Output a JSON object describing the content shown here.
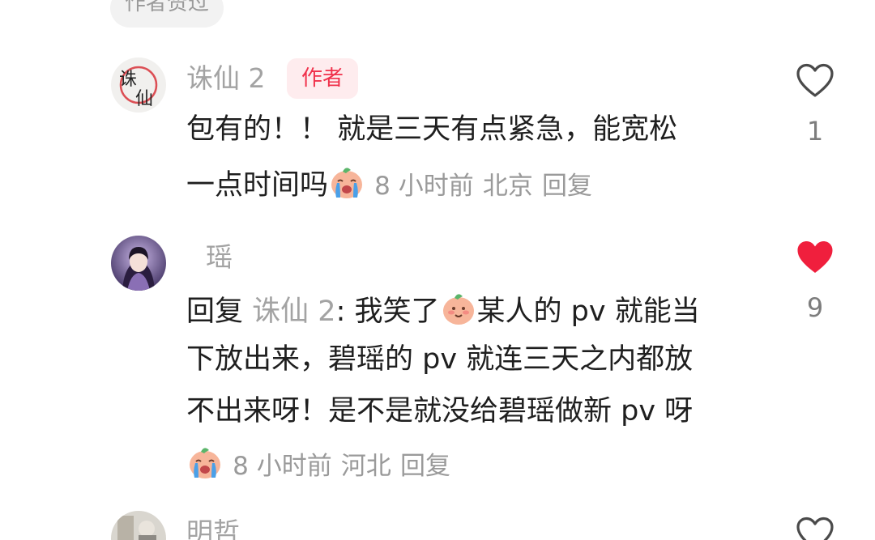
{
  "top_badge": {
    "label": "作者赞过"
  },
  "comments": [
    {
      "username": "诛仙 2",
      "author_badge": "作者",
      "lines": [
        "包有的！！ 就是三天有点紧急，能宽松",
        "一点时间吗"
      ],
      "emoji": "crying-face-emoji",
      "time": "8 小时前",
      "location": "北京",
      "reply_label": "回复",
      "likes": "1",
      "liked": false,
      "avatar_text": "诛仙"
    },
    {
      "username": "瑶",
      "reply_prefix": "回复",
      "reply_to": "诛仙 2",
      "reply_sep": ":",
      "lines": [
        "我笑了",
        "某人的 pv 就能当",
        "下放出来，碧瑶的 pv 就连三天之内都放",
        "不出来呀！是不是就没给碧瑶做新 pv 呀"
      ],
      "emoji_inline": "smiling-face-emoji",
      "emoji": "crying-face-emoji",
      "time": "8 小时前",
      "location": "河北",
      "reply_label": "回复",
      "likes": "9",
      "liked": true
    },
    {
      "username": "明哲",
      "liked": false
    }
  ],
  "colors": {
    "accent_red": "#f0314b",
    "muted_text": "#a3a3a3",
    "body_text": "#1f1f1f",
    "heart_liked": "#f01f3d"
  }
}
